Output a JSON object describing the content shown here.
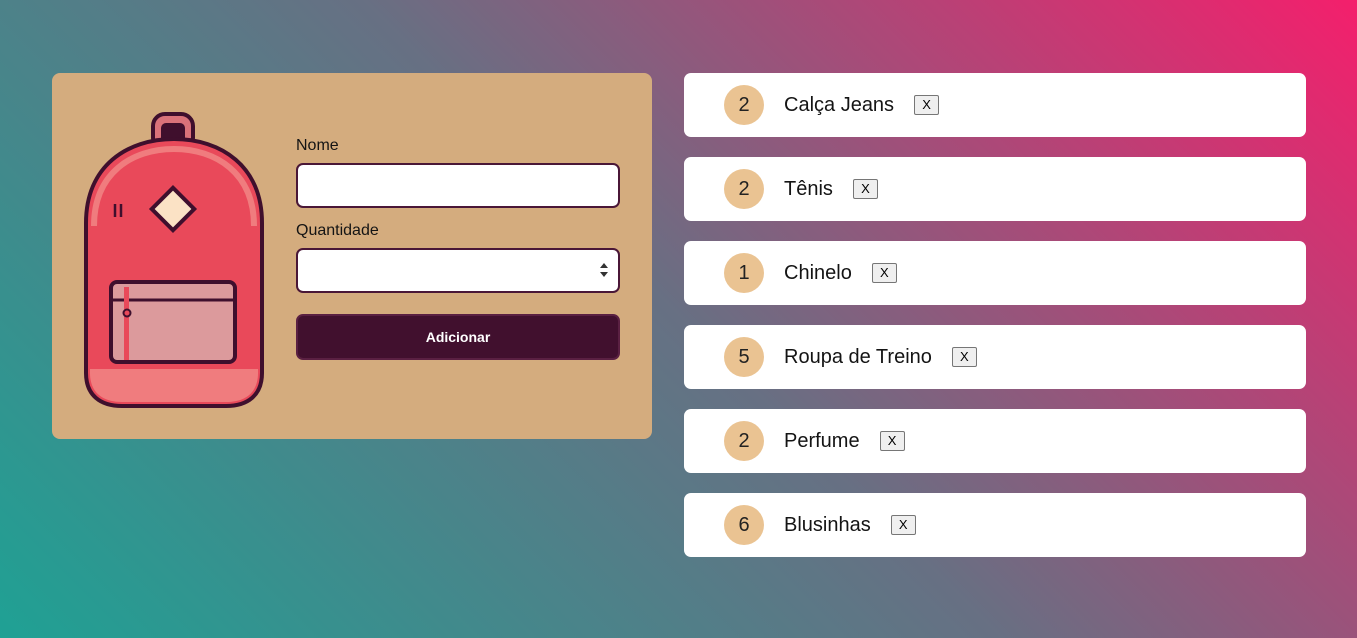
{
  "form": {
    "name_label": "Nome",
    "name_value": "",
    "quantity_label": "Quantidade",
    "quantity_value": "",
    "submit_label": "Adicionar"
  },
  "items": [
    {
      "quantity": "2",
      "name": "Calça Jeans",
      "remove_label": "X"
    },
    {
      "quantity": "2",
      "name": "Tênis",
      "remove_label": "X"
    },
    {
      "quantity": "1",
      "name": "Chinelo",
      "remove_label": "X"
    },
    {
      "quantity": "5",
      "name": "Roupa de Treino",
      "remove_label": "X"
    },
    {
      "quantity": "2",
      "name": "Perfume",
      "remove_label": "X"
    },
    {
      "quantity": "6",
      "name": "Blusinhas",
      "remove_label": "X"
    }
  ],
  "colors": {
    "form_card": "#d4ac7e",
    "button": "#41102e",
    "badge": "#eac392",
    "gradient_start": "#1fa194",
    "gradient_end": "#f41f6c"
  },
  "icons": {
    "illustration": "backpack-icon",
    "spinner": "number-spinner-icon"
  }
}
